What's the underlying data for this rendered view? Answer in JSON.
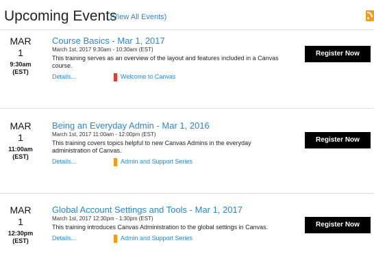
{
  "header": {
    "title": "Upcoming Events",
    "view_all": "(View All Events)"
  },
  "colors": {
    "link": "#2a87d0",
    "button": "#000000",
    "rss": "#f39c19"
  },
  "events": [
    {
      "month": "MAR",
      "day": "1",
      "time": "9:30am",
      "zone": "(EST)",
      "title": "Course Basics - Mar 1, 2017",
      "when": "March 1st, 2017 9:30am - 10:30am (EST)",
      "description": "This training serves as an overview of the layout and features included in a Canvas course.",
      "details": "Details...",
      "tag": "Welcome to Canvas",
      "tag_color": "#e23b3b",
      "register": "Register Now"
    },
    {
      "month": "MAR",
      "day": "1",
      "time": "11:00am",
      "zone": "(EST)",
      "title": "Being an Everyday Admin - Mar 1, 2016",
      "when": "March 1st, 2017 11:00am - 12:00pm (EST)",
      "description": "This training covers topics helpful to new Canvas Admins in the everyday administration of Canvas.",
      "details": "Details...",
      "tag": "Admin and Support Series",
      "tag_color": "#f39c19",
      "register": "Register Now"
    },
    {
      "month": "MAR",
      "day": "1",
      "time": "12:30pm",
      "zone": "(EST)",
      "title": "Global Account Settings and Tools - Mar 1, 2017",
      "when": "March 1st, 2017 12:30pm - 1:30pm (EST)",
      "description": "This training introduces Canvas Administration to the global settings in Canvas.",
      "details": "Details...",
      "tag": "Admin and Support Series",
      "tag_color": "#f39c19",
      "register": "Register Now"
    }
  ]
}
